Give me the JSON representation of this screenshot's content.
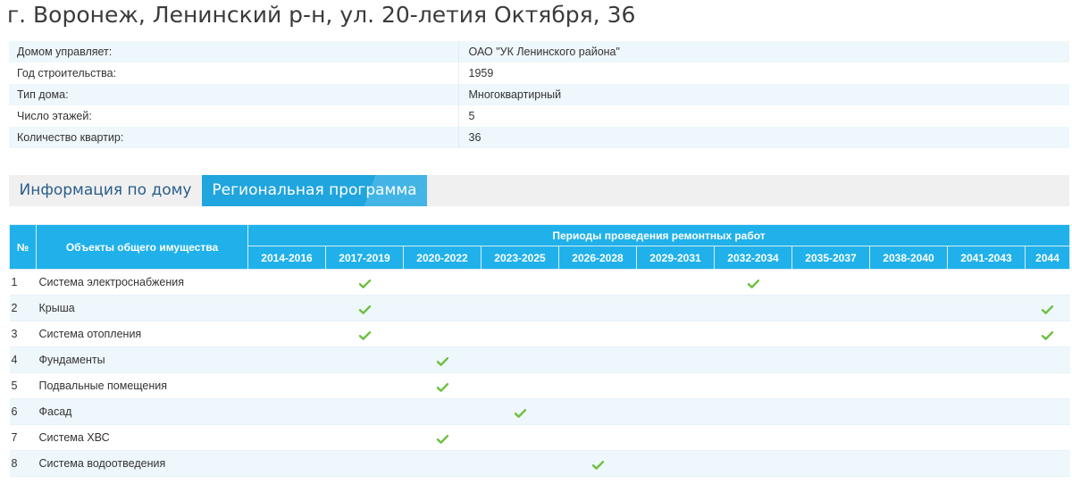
{
  "page": {
    "title": "г. Воронеж, Ленинский р-н, ул. 20-летия Октября, 36"
  },
  "info_rows": [
    {
      "label": "Домом управляет:",
      "value": "ОАО \"УК Ленинского района\""
    },
    {
      "label": "Год строительства:",
      "value": "1959"
    },
    {
      "label": "Тип дома:",
      "value": "Многоквартирный"
    },
    {
      "label": "Число этажей:",
      "value": "5"
    },
    {
      "label": "Количество квартир:",
      "value": "36"
    }
  ],
  "tabs": {
    "info": "Информация по дому",
    "program": "Региональная программа",
    "active": "program"
  },
  "program": {
    "header": {
      "num": "№",
      "objects": "Объекты общего имущества",
      "periods": "Периоды проведения ремонтных работ"
    },
    "periods": [
      "2014-2016",
      "2017-2019",
      "2020-2022",
      "2023-2025",
      "2026-2028",
      "2029-2031",
      "2032-2034",
      "2035-2037",
      "2038-2040",
      "2041-2043",
      "2044"
    ],
    "rows": [
      {
        "num": "1",
        "name": "Система электроснабжения",
        "checks": [
          false,
          true,
          false,
          false,
          false,
          false,
          true,
          false,
          false,
          false,
          false
        ]
      },
      {
        "num": "2",
        "name": "Крыша",
        "checks": [
          false,
          true,
          false,
          false,
          false,
          false,
          false,
          false,
          false,
          false,
          true
        ]
      },
      {
        "num": "3",
        "name": "Система отопления",
        "checks": [
          false,
          true,
          false,
          false,
          false,
          false,
          false,
          false,
          false,
          false,
          true
        ]
      },
      {
        "num": "4",
        "name": "Фундаменты",
        "checks": [
          false,
          false,
          true,
          false,
          false,
          false,
          false,
          false,
          false,
          false,
          false
        ]
      },
      {
        "num": "5",
        "name": "Подвальные помещения",
        "checks": [
          false,
          false,
          true,
          false,
          false,
          false,
          false,
          false,
          false,
          false,
          false
        ]
      },
      {
        "num": "6",
        "name": "Фасад",
        "checks": [
          false,
          false,
          false,
          true,
          false,
          false,
          false,
          false,
          false,
          false,
          false
        ]
      },
      {
        "num": "7",
        "name": "Система ХВС",
        "checks": [
          false,
          false,
          true,
          false,
          false,
          false,
          false,
          false,
          false,
          false,
          false
        ]
      },
      {
        "num": "8",
        "name": "Система водоотведения",
        "checks": [
          false,
          false,
          false,
          false,
          true,
          false,
          false,
          false,
          false,
          false,
          false
        ]
      }
    ]
  },
  "colors": {
    "accent": "#20b1ea",
    "check": "#6cbf3f",
    "row_alt": "#eef7fb"
  },
  "icons": {
    "check": "check-icon"
  }
}
